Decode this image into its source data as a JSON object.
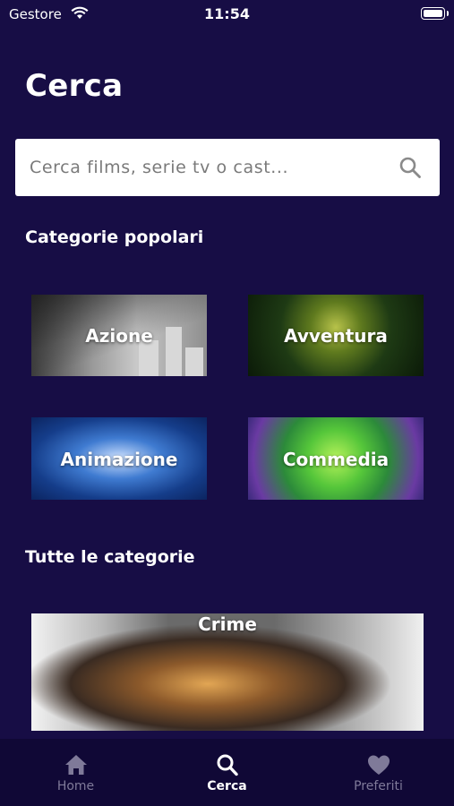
{
  "status_bar": {
    "carrier": "Gestore",
    "time": "11:54"
  },
  "page": {
    "title": "Cerca"
  },
  "search": {
    "placeholder": "Cerca films, serie tv o cast..."
  },
  "sections": {
    "popular_title": "Categorie popolari",
    "all_title": "Tutte le categorie"
  },
  "popular_categories": [
    {
      "label": "Azione"
    },
    {
      "label": "Avventura"
    },
    {
      "label": "Animazione"
    },
    {
      "label": "Commedia"
    }
  ],
  "all_categories": [
    {
      "label": "Crime"
    }
  ],
  "tab_bar": {
    "items": [
      {
        "label": "Home",
        "icon": "home-icon",
        "active": false
      },
      {
        "label": "Cerca",
        "icon": "search-icon",
        "active": true
      },
      {
        "label": "Preferiti",
        "icon": "heart-icon",
        "active": false
      }
    ]
  },
  "colors": {
    "background": "#170d45",
    "tab_bar": "#100836",
    "tab_inactive": "#7f7a99",
    "tab_active": "#ffffff"
  }
}
